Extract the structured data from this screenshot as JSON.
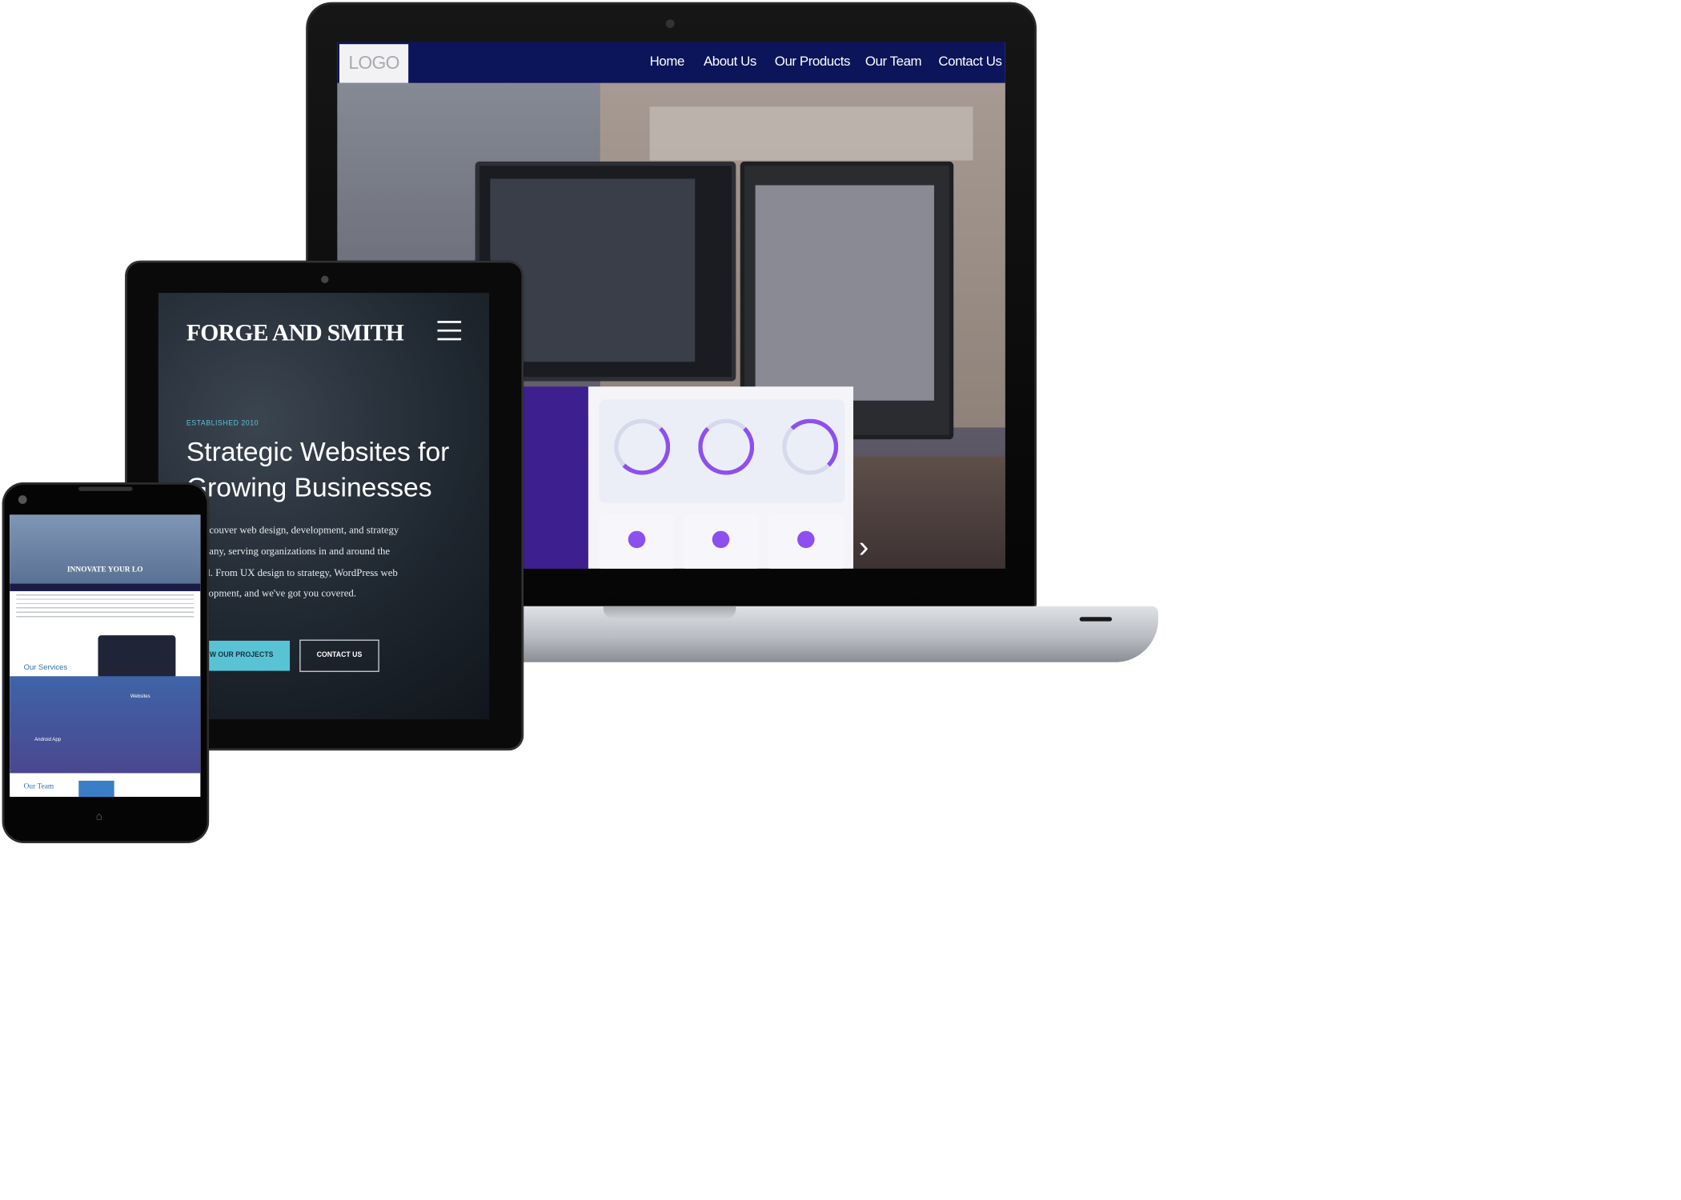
{
  "laptop": {
    "logo": "LOGO",
    "nav": [
      "Home",
      "About Us",
      "Our Products",
      "Our Team",
      "Contact Us"
    ],
    "slider_next": "›"
  },
  "tablet": {
    "brand": "FORGE AND SMITH",
    "established": "ESTABLISHED 2010",
    "headline": "Strategic Websites for Growing Businesses",
    "paragraph": "a Vancouver web design, development, and strategy company, serving organizations in and around the world. From UX design to strategy, WordPress web development, and we've got you covered.",
    "primary_button": "IEW OUR PROJECTS",
    "secondary_button": "CONTACT US",
    "menu_icon": "hamburger-icon"
  },
  "phone": {
    "hero_title": "INNOVATE YOUR LO",
    "services_heading": "Our Services",
    "websites_label": "Websites",
    "android_label": "Android App",
    "team_heading": "Our Team",
    "home_icon": "home-icon"
  }
}
